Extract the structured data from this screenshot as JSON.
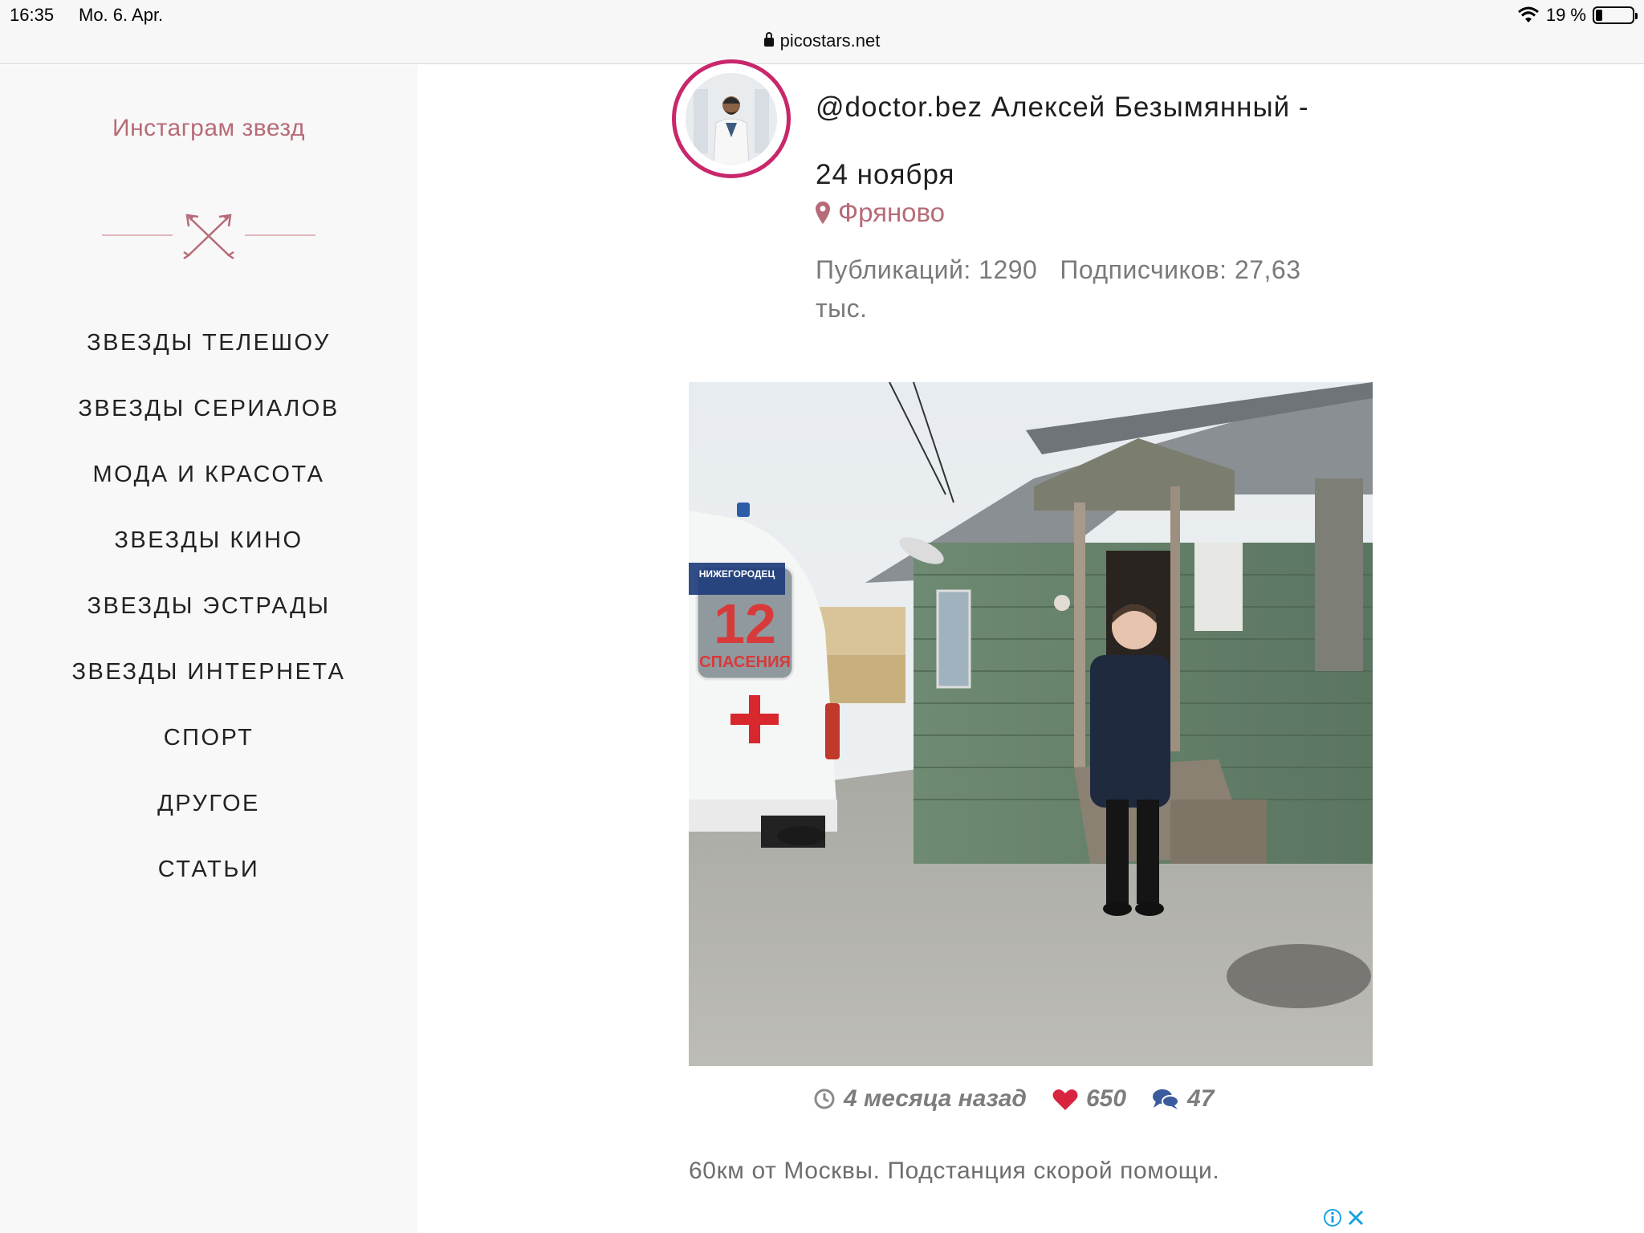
{
  "status_bar": {
    "time": "16:35",
    "date": "Mo. 6. Apr.",
    "battery_text": "19 %",
    "battery_level": 0.19,
    "url": "picostars.net"
  },
  "sidebar": {
    "brand": "Инстаграм звезд",
    "items": [
      {
        "label": "ЗВЕЗДЫ ТЕЛЕШОУ"
      },
      {
        "label": "ЗВЕЗДЫ СЕРИАЛОВ"
      },
      {
        "label": "МОДА И КРАСОТА"
      },
      {
        "label": "ЗВЕЗДЫ КИНО"
      },
      {
        "label": "ЗВЕЗДЫ ЭСТРАДЫ"
      },
      {
        "label": "ЗВЕЗДЫ ИНТЕРНЕТА"
      },
      {
        "label": "СПОРТ"
      },
      {
        "label": "ДРУГОЕ"
      },
      {
        "label": "СТАТЬИ"
      }
    ]
  },
  "profile": {
    "title_line1": "@doctor.bez Алексей Безымянный -",
    "title_line2": "24 ноября",
    "location": "Фряново",
    "posts": "Публикаций: 1290",
    "followers": "Подписчиков: 27,63 тыс."
  },
  "post": {
    "photo_text": {
      "number": "12",
      "spaseniya": "СПАСЕНИЯ",
      "sign": "НИЖЕГОРОДЕЦ"
    },
    "time_ago": "4 месяца назад",
    "likes": "650",
    "comments": "47",
    "caption": "60км от Москвы. Подстанция скорой помощи."
  },
  "colors": {
    "accent": "#b76b77",
    "ring": "#c8276b",
    "heart": "#d8243f",
    "comment": "#3a5b9c",
    "adchoices": "#1aa3e0"
  },
  "icons": [
    "lock-icon",
    "wifi-icon",
    "battery-icon",
    "arrows-cross-icon",
    "map-pin-icon",
    "clock-icon",
    "heart-icon",
    "comments-icon",
    "adchoices-icon",
    "close-icon"
  ]
}
